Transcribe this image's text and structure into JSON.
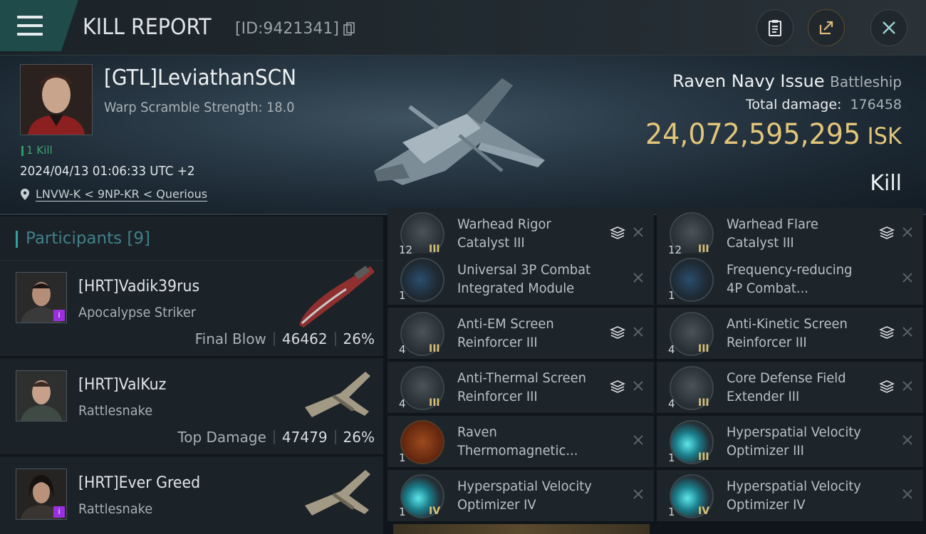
{
  "header": {
    "title": "KILL REPORT",
    "report_id": "[ID:9421341]"
  },
  "victim": {
    "name": "[GTL]LeviathanSCN",
    "warp_scramble": "Warp Scramble Strength: 18.0",
    "kill_count": "1 Kill",
    "datetime": "2024/04/13 01:06:33 UTC +2",
    "location": "LNVW-K < 9NP-KR < Querious",
    "ship_name": "Raven Navy Issue",
    "ship_class": "Battleship",
    "total_damage_label": "Total damage:",
    "total_damage": "176458",
    "isk_value": "24,072,595,295",
    "isk_unit": "ISK",
    "result": "Kill"
  },
  "participants": {
    "label": "Participants",
    "count": "[9]",
    "rows": [
      {
        "name": "[HRT]Vadik39rus",
        "ship": "Apocalypse Striker",
        "stat_label": "Final Blow",
        "damage": "46462",
        "percent": "26%"
      },
      {
        "name": "[HRT]ValKuz",
        "ship": "Rattlesnake",
        "stat_label": "Top Damage",
        "damage": "47479",
        "percent": "26%"
      },
      {
        "name": "[HRT]Ever Greed",
        "ship": "Rattlesnake",
        "stat_label": "",
        "damage": "",
        "percent": ""
      }
    ]
  },
  "modules": {
    "left": [
      {
        "label": "Warhead Rigor Catalyst III",
        "qty": "12",
        "tier": "III",
        "stacked": true
      },
      {
        "label": "Universal 3P Combat Integrated Module",
        "qty": "1",
        "tier": "",
        "stacked": false
      },
      {
        "label": "Anti-EM Screen Reinforcer III",
        "qty": "4",
        "tier": "III",
        "stacked": true
      },
      {
        "label": "Anti-Thermal Screen Reinforcer III",
        "qty": "4",
        "tier": "III",
        "stacked": true
      },
      {
        "label": "Raven Thermomagnetic...",
        "qty": "1",
        "tier": "",
        "stacked": false
      },
      {
        "label": "Hyperspatial Velocity Optimizer IV",
        "qty": "1",
        "tier": "IV",
        "stacked": false
      }
    ],
    "right": [
      {
        "label": "Warhead Flare Catalyst III",
        "qty": "12",
        "tier": "III",
        "stacked": true
      },
      {
        "label": "Frequency-reducing 4P Combat...",
        "qty": "1",
        "tier": "",
        "stacked": false
      },
      {
        "label": "Anti-Kinetic Screen Reinforcer III",
        "qty": "4",
        "tier": "III",
        "stacked": true
      },
      {
        "label": "Core Defense Field Extender III",
        "qty": "4",
        "tier": "III",
        "stacked": true
      },
      {
        "label": "Hyperspatial Velocity Optimizer III",
        "qty": "1",
        "tier": "III",
        "stacked": false
      },
      {
        "label": "Hyperspatial Velocity Optimizer IV",
        "qty": "1",
        "tier": "IV",
        "stacked": false
      }
    ]
  }
}
